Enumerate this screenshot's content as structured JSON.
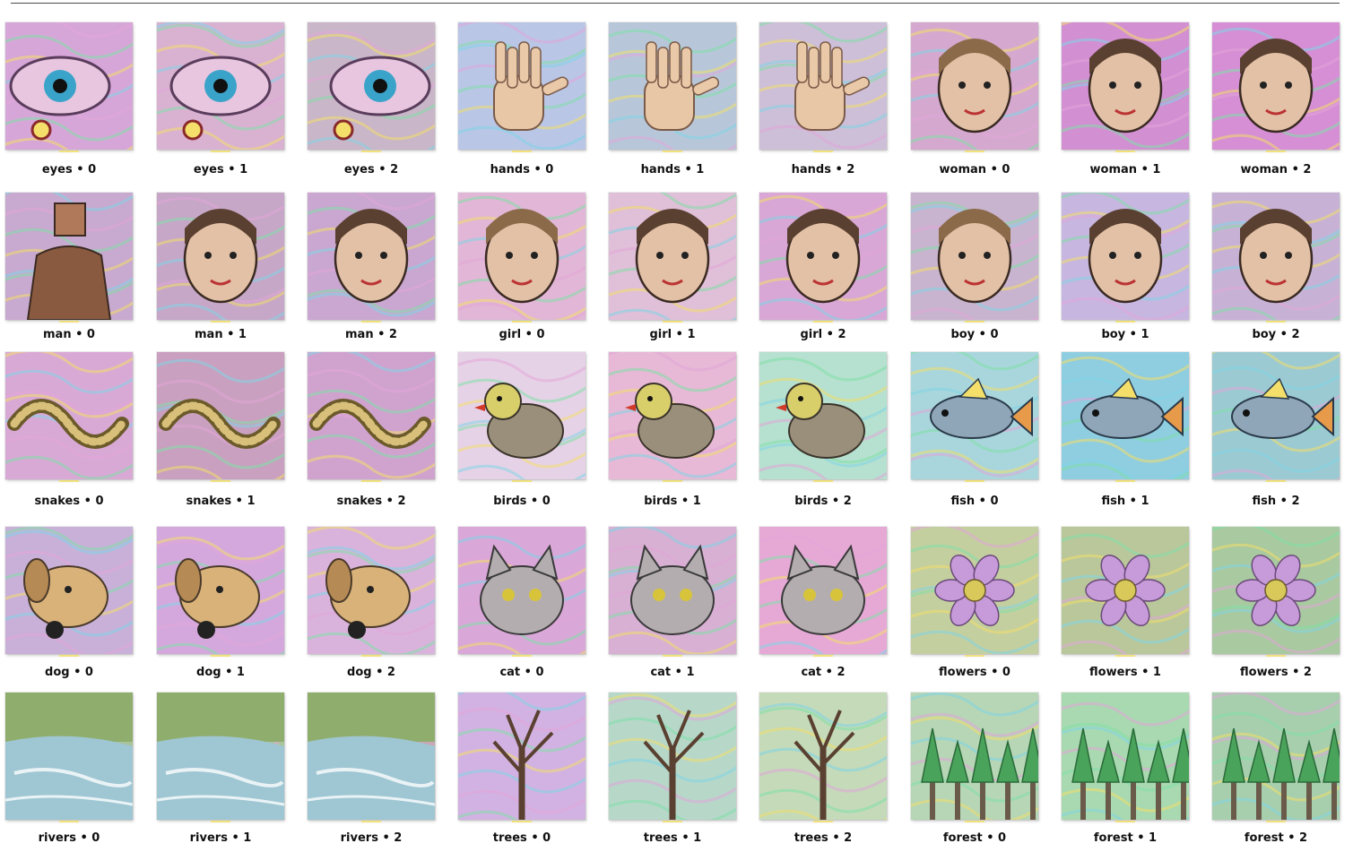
{
  "grid": {
    "subjects": [
      [
        "eyes",
        "hands",
        "woman"
      ],
      [
        "man",
        "girl",
        "boy"
      ],
      [
        "snakes",
        "birds",
        "fish"
      ],
      [
        "dog",
        "cat",
        "flowers"
      ],
      [
        "rivers",
        "trees",
        "forest"
      ]
    ],
    "variants": [
      "0",
      "1",
      "2"
    ],
    "separator": " • ",
    "cells": [
      {
        "label": "eyes • 0",
        "subject": "eyes",
        "icon": "eye-icon",
        "bg": "#d7a6d8"
      },
      {
        "label": "eyes • 1",
        "subject": "eyes",
        "icon": "eye-icon",
        "bg": "#d9b2d2"
      },
      {
        "label": "eyes • 2",
        "subject": "eyes",
        "icon": "eye-icon",
        "bg": "#c9b6c8"
      },
      {
        "label": "hands • 0",
        "subject": "hands",
        "icon": "hand-icon",
        "bg": "#b9c6e6"
      },
      {
        "label": "hands • 1",
        "subject": "hands",
        "icon": "hand-icon",
        "bg": "#b7c7d9"
      },
      {
        "label": "hands • 2",
        "subject": "hands",
        "icon": "hand-icon",
        "bg": "#cdbfd8"
      },
      {
        "label": "woman • 0",
        "subject": "woman",
        "icon": "face-icon",
        "bg": "#d5a9cf"
      },
      {
        "label": "woman • 1",
        "subject": "woman",
        "icon": "face-icon",
        "bg": "#d28fd2"
      },
      {
        "label": "woman • 2",
        "subject": "woman",
        "icon": "face-icon",
        "bg": "#d68fd4"
      },
      {
        "label": "man • 0",
        "subject": "man",
        "icon": "person-icon",
        "bg": "#c8a9cf"
      },
      {
        "label": "man • 1",
        "subject": "man",
        "icon": "face-icon",
        "bg": "#c6a7c7"
      },
      {
        "label": "man • 2",
        "subject": "man",
        "icon": "face-icon",
        "bg": "#c9a7d0"
      },
      {
        "label": "girl • 0",
        "subject": "girl",
        "icon": "face-icon",
        "bg": "#e2b6d6"
      },
      {
        "label": "girl • 1",
        "subject": "girl",
        "icon": "face-icon",
        "bg": "#e0bfd8"
      },
      {
        "label": "girl • 2",
        "subject": "girl",
        "icon": "face-icon",
        "bg": "#d8a7d6"
      },
      {
        "label": "boy • 0",
        "subject": "boy",
        "icon": "face-icon",
        "bg": "#c9b4cf"
      },
      {
        "label": "boy • 1",
        "subject": "boy",
        "icon": "face-icon",
        "bg": "#c7b6e0"
      },
      {
        "label": "boy • 2",
        "subject": "boy",
        "icon": "face-icon",
        "bg": "#c7b2d6"
      },
      {
        "label": "snakes • 0",
        "subject": "snakes",
        "icon": "snake-icon",
        "bg": "#d9a9d6"
      },
      {
        "label": "snakes • 1",
        "subject": "snakes",
        "icon": "snake-icon",
        "bg": "#c9a0bf"
      },
      {
        "label": "snakes • 2",
        "subject": "snakes",
        "icon": "snake-icon",
        "bg": "#d0a3cf"
      },
      {
        "label": "birds • 0",
        "subject": "birds",
        "icon": "bird-icon",
        "bg": "#e6d2e6"
      },
      {
        "label": "birds • 1",
        "subject": "birds",
        "icon": "bird-icon",
        "bg": "#e7b9d6"
      },
      {
        "label": "birds • 2",
        "subject": "birds",
        "icon": "bird-icon",
        "bg": "#b6e0cf"
      },
      {
        "label": "fish • 0",
        "subject": "fish",
        "icon": "fish-icon",
        "bg": "#a9d6dc"
      },
      {
        "label": "fish • 1",
        "subject": "fish",
        "icon": "fish-icon",
        "bg": "#8fcde0"
      },
      {
        "label": "fish • 2",
        "subject": "fish",
        "icon": "fish-icon",
        "bg": "#9ccad2"
      },
      {
        "label": "dog • 0",
        "subject": "dog",
        "icon": "dog-icon",
        "bg": "#c9b0d9"
      },
      {
        "label": "dog • 1",
        "subject": "dog",
        "icon": "dog-icon",
        "bg": "#d5a8dd"
      },
      {
        "label": "dog • 2",
        "subject": "dog",
        "icon": "dog-icon",
        "bg": "#dab3dc"
      },
      {
        "label": "cat • 0",
        "subject": "cat",
        "icon": "cat-icon",
        "bg": "#d9a7d8"
      },
      {
        "label": "cat • 1",
        "subject": "cat",
        "icon": "cat-icon",
        "bg": "#d7b0d3"
      },
      {
        "label": "cat • 2",
        "subject": "cat",
        "icon": "cat-icon",
        "bg": "#e6a9d6"
      },
      {
        "label": "flowers • 0",
        "subject": "flowers",
        "icon": "flower-icon",
        "bg": "#c4cfa0"
      },
      {
        "label": "flowers • 1",
        "subject": "flowers",
        "icon": "flower-icon",
        "bg": "#b9c79b"
      },
      {
        "label": "flowers • 2",
        "subject": "flowers",
        "icon": "flower-icon",
        "bg": "#a9c9a0"
      },
      {
        "label": "rivers • 0",
        "subject": "rivers",
        "icon": "river-icon",
        "bg": "#a8c39a"
      },
      {
        "label": "rivers • 1",
        "subject": "rivers",
        "icon": "river-icon",
        "bg": "#aac59c"
      },
      {
        "label": "rivers • 2",
        "subject": "rivers",
        "icon": "river-icon",
        "bg": "#c9a7b6"
      },
      {
        "label": "trees • 0",
        "subject": "trees",
        "icon": "tree-icon",
        "bg": "#d2b2e2"
      },
      {
        "label": "trees • 1",
        "subject": "trees",
        "icon": "tree-icon",
        "bg": "#b7d7c9"
      },
      {
        "label": "trees • 2",
        "subject": "trees",
        "icon": "tree-icon",
        "bg": "#c4dab9"
      },
      {
        "label": "forest • 0",
        "subject": "forest",
        "icon": "forest-icon",
        "bg": "#b6d6b5"
      },
      {
        "label": "forest • 1",
        "subject": "forest",
        "icon": "forest-icon",
        "bg": "#a9d9b0"
      },
      {
        "label": "forest • 2",
        "subject": "forest",
        "icon": "forest-icon",
        "bg": "#a7cfae"
      }
    ]
  },
  "colors": {
    "caption_text": "#111111",
    "psychedelic_pink": "#e2a6d8",
    "psychedelic_green": "#7fe0a8",
    "psychedelic_yellow": "#f3df6a",
    "psychedelic_cyan": "#7fd6e6"
  }
}
